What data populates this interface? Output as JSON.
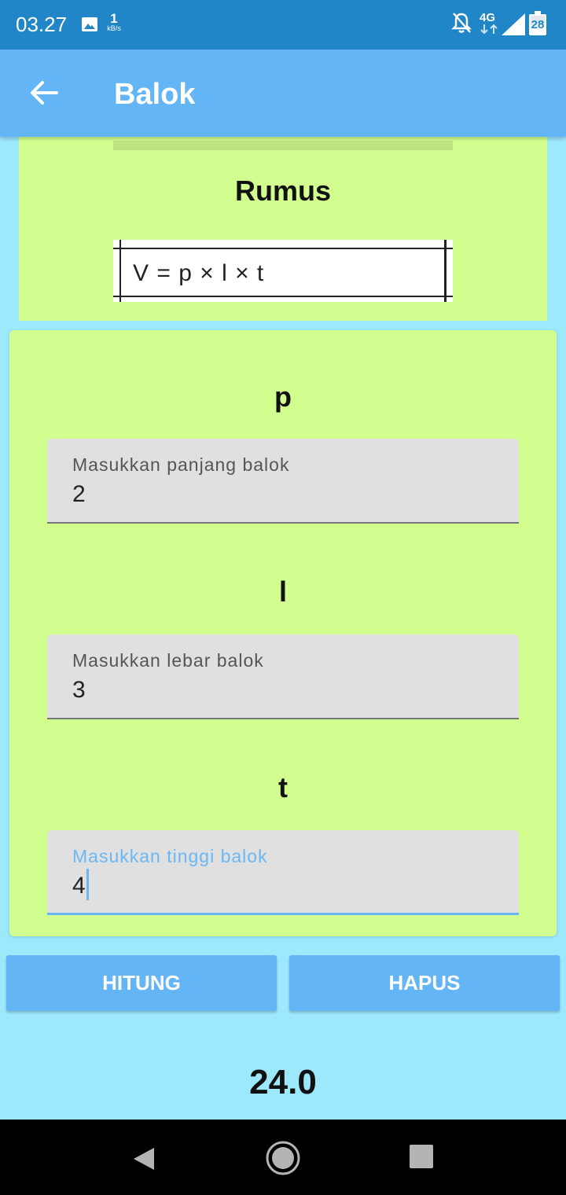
{
  "status_bar": {
    "time": "03.27",
    "speed_value": "1",
    "speed_unit": "kB/s",
    "network": "4G",
    "battery": "28"
  },
  "app_bar": {
    "title": "Balok",
    "back_icon": "arrow-left-icon"
  },
  "formula": {
    "heading": "Rumus",
    "expression": "V = p × l × t"
  },
  "inputs": [
    {
      "label": "p",
      "hint": "Masukkan panjang balok",
      "value": "2",
      "focused": false
    },
    {
      "label": "l",
      "hint": "Masukkan lebar balok",
      "value": "3",
      "focused": false
    },
    {
      "label": "t",
      "hint": "Masukkan tinggi balok",
      "value": "4",
      "focused": true
    }
  ],
  "buttons": {
    "calculate": "HITUNG",
    "clear": "HAPUS"
  },
  "result": "24.0",
  "colors": {
    "status_bar": "#2186c7",
    "app_bar": "#63b5f6",
    "background": "#9ce8fc",
    "card": "#d1fe8e",
    "accent": "#6ab7f5"
  }
}
